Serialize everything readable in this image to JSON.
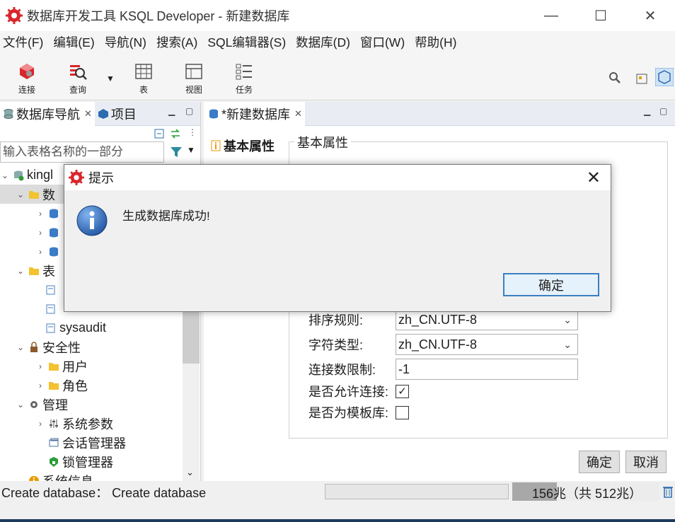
{
  "window": {
    "title": "数据库开发工具 KSQL Developer - 新建数据库",
    "minimize": "—",
    "maximize": "☐",
    "close": "✕"
  },
  "menu": [
    "文件(F)",
    "编辑(E)",
    "导航(N)",
    "搜索(A)",
    "SQL编辑器(S)",
    "数据库(D)",
    "窗口(W)",
    "帮助(H)"
  ],
  "toolbar": {
    "connect": "连接",
    "query": "查询",
    "table": "表",
    "view": "视图",
    "task": "任务"
  },
  "left_panel": {
    "tabs": [
      {
        "label": "数据库导航",
        "close": "✕"
      },
      {
        "label": "项目"
      }
    ],
    "filter_placeholder": "输入表格名称的一部分",
    "tree": [
      {
        "label": "kingl",
        "expanded": true,
        "icon": "database-connection-icon"
      },
      {
        "label": "数",
        "expanded": true,
        "icon": "folder-icon"
      },
      {
        "label": "",
        "icon": "database-icon"
      },
      {
        "label": "",
        "icon": "database-icon"
      },
      {
        "label": "",
        "icon": "database-icon"
      },
      {
        "label": "表",
        "expanded": true,
        "icon": "folder-icon"
      },
      {
        "label": "",
        "icon": "table-icon"
      },
      {
        "label": "",
        "icon": "table-icon"
      },
      {
        "label": "sysaudit",
        "icon": "table-icon"
      },
      {
        "label": "安全性",
        "expanded": true,
        "icon": "lock-icon"
      },
      {
        "label": "用户",
        "icon": "folder-icon"
      },
      {
        "label": "角色",
        "icon": "folder-icon"
      },
      {
        "label": "管理",
        "expanded": true,
        "icon": "gear-icon"
      },
      {
        "label": "系统参数",
        "icon": "sliders-icon"
      },
      {
        "label": "会话管理器",
        "icon": "session-icon"
      },
      {
        "label": "锁管理器",
        "icon": "lock-icon"
      },
      {
        "label": "系统信息",
        "icon": "info-icon"
      }
    ]
  },
  "editor": {
    "tab_label": "*新建数据库",
    "tab_close": "✕",
    "side_tab": "基本属性",
    "group_title": "基本属性",
    "fields": {
      "collation_label": "排序规则:",
      "collation_value": "zh_CN.UTF-8",
      "ctype_label": "字符类型:",
      "ctype_value": "zh_CN.UTF-8",
      "conn_limit_label": "连接数限制:",
      "conn_limit_value": "-1",
      "allow_conn_label": "是否允许连接:",
      "allow_conn_checked": true,
      "template_label": "是否为模板库:",
      "template_checked": false
    },
    "ok": "确定",
    "cancel": "取消"
  },
  "status": {
    "text": "Create database： Create database",
    "memory": "156兆（共 512兆）",
    "memory_fraction": 0.305
  },
  "dialog": {
    "title": "提示",
    "message": "生成数据库成功!",
    "ok": "确定",
    "close": "✕"
  },
  "colors": {
    "brand_red": "#d9262c",
    "accent_blue": "#3c7fc1",
    "info_blue": "#1e5fb4"
  }
}
